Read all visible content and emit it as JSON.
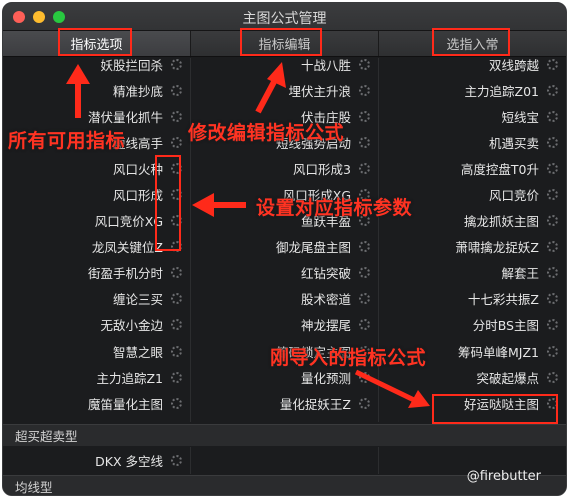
{
  "window": {
    "title": "主图公式管理"
  },
  "tabs": [
    {
      "label": "指标选项",
      "active": true
    },
    {
      "label": "指标编辑",
      "active": false
    },
    {
      "label": "选指入常",
      "active": false
    }
  ],
  "columns": [
    {
      "items": [
        "妖股拦回杀",
        "精准抄底",
        "潜伏量化抓牛",
        "短线高手",
        "风口火种",
        "风口形成",
        "风口竞价XG",
        "龙凤关键位Z",
        "街盈手机分时",
        "缠论三买",
        "无敌小金边",
        "智慧之眼",
        "主力追踪Z1",
        "魔笛量化主图"
      ]
    },
    {
      "items": [
        "十战八胜",
        "埋伏主升浪",
        "伏击庄股",
        "短线强势启动",
        "风口形成3",
        "风口形成XG",
        "鱼跃丰盈",
        "御龙尾盘主图",
        "红钻突破",
        "股术密道",
        "神龙摆尾",
        "筹码锁定主图",
        "量化预测",
        "量化捉妖王Z"
      ]
    },
    {
      "items": [
        "双线跨越",
        "主力追踪Z01",
        "短线宝",
        "机遇买卖",
        "高度控盘T0升",
        "风口竞价",
        "擒龙抓妖主图",
        "萧啸擒龙捉妖Z",
        "解套王",
        "十七彩共振Z",
        "分时BS主图",
        "筹码单峰MJZ1",
        "突破起爆点",
        "好运哒哒主图"
      ]
    }
  ],
  "sections": {
    "overbought": "超买超卖型",
    "overbought_items": [
      "DKX 多空线",
      "",
      ""
    ],
    "ma": "均线型"
  },
  "annotations": {
    "all_indicators": "所有可用指标",
    "edit_formula": "修改编辑指标公式",
    "set_params": "设置对应指标参数",
    "just_imported": "刚导入的指标公式"
  },
  "watermark": "@firebutter",
  "colors": {
    "annotation_red": "#ff2a1a",
    "window_bg": "#1b1c1e"
  }
}
